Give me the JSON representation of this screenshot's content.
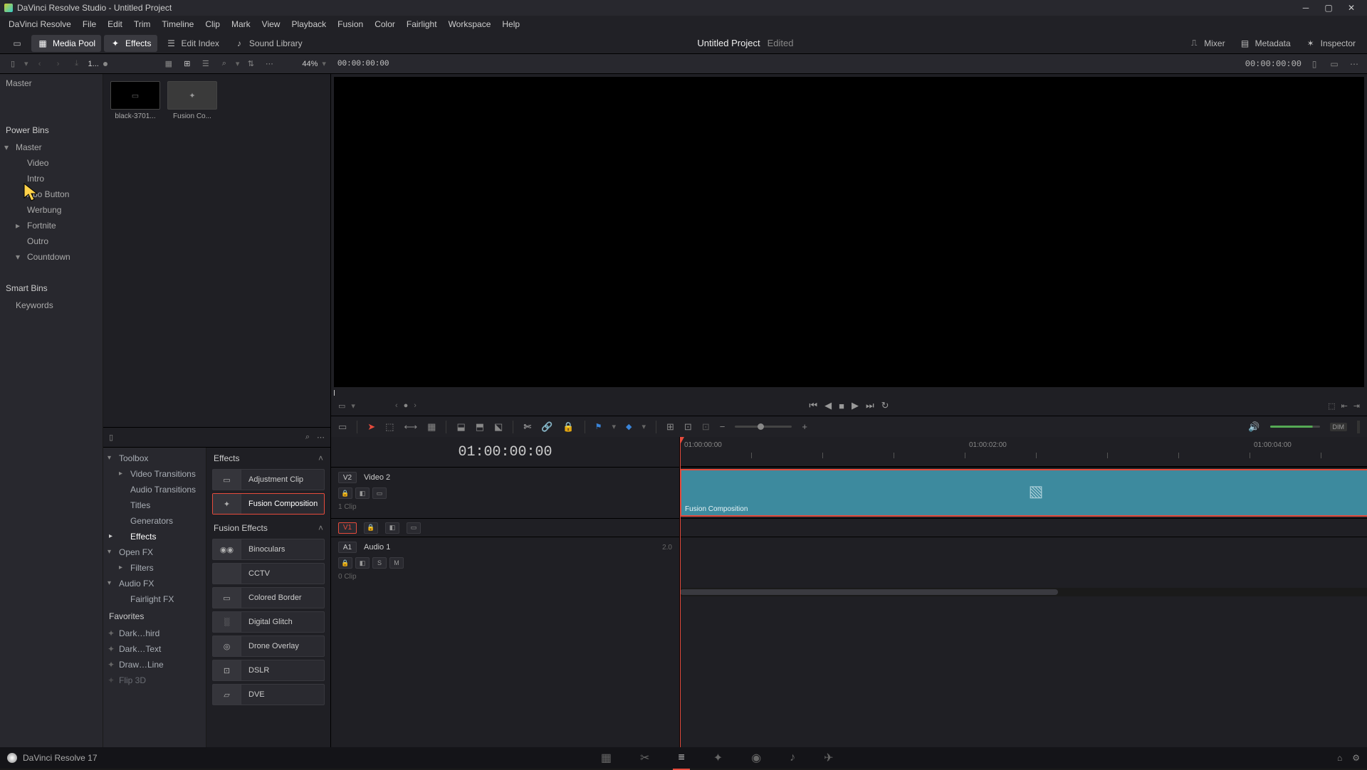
{
  "window": {
    "title": "DaVinci Resolve Studio - Untitled Project"
  },
  "menu": [
    "DaVinci Resolve",
    "File",
    "Edit",
    "Trim",
    "Timeline",
    "Clip",
    "Mark",
    "View",
    "Playback",
    "Fusion",
    "Color",
    "Fairlight",
    "Workspace",
    "Help"
  ],
  "toolbar_left": [
    {
      "id": "media-pool",
      "label": "Media Pool",
      "active": true
    },
    {
      "id": "effects",
      "label": "Effects",
      "active": true
    },
    {
      "id": "edit-index",
      "label": "Edit Index",
      "active": false
    },
    {
      "id": "sound-library",
      "label": "Sound Library",
      "active": false
    }
  ],
  "toolbar_center": {
    "project": "Untitled Project",
    "status": "Edited"
  },
  "toolbar_right": [
    {
      "id": "mixer",
      "label": "Mixer"
    },
    {
      "id": "metadata",
      "label": "Metadata"
    },
    {
      "id": "inspector",
      "label": "Inspector"
    }
  ],
  "secondbar": {
    "timeline_name": "1...",
    "zoom": "44%",
    "tc_left": "00:00:00:00",
    "tc_right": "00:00:00:00"
  },
  "bins": {
    "top": "Master",
    "power_label": "Power Bins",
    "power_items": [
      {
        "label": "Master",
        "expand": "down"
      },
      {
        "label": "Video",
        "lvl": 2
      },
      {
        "label": "Intro",
        "lvl": 2
      },
      {
        "label": "Abo Button",
        "lvl": 2
      },
      {
        "label": "Werbung",
        "lvl": 2
      },
      {
        "label": "Fortnite",
        "lvl": 2,
        "expand": "right"
      },
      {
        "label": "Outro",
        "lvl": 2
      },
      {
        "label": "Countdown",
        "lvl": 2,
        "expand": "down"
      }
    ],
    "smart_label": "Smart Bins",
    "smart_items": [
      {
        "label": "Keywords"
      }
    ]
  },
  "media": {
    "clips": [
      {
        "name": "black-3701...",
        "dark": true
      },
      {
        "name": "Fusion Co...",
        "dark": false
      }
    ]
  },
  "effects_tree": {
    "toolbox": "Toolbox",
    "toolbox_items": [
      {
        "label": "Video Transitions",
        "expand": "right"
      },
      {
        "label": "Audio Transitions"
      },
      {
        "label": "Titles"
      },
      {
        "label": "Generators"
      },
      {
        "label": "Effects",
        "selected": true,
        "expand": "right"
      }
    ],
    "openfx": "Open FX",
    "openfx_items": [
      {
        "label": "Filters",
        "expand": "right"
      }
    ],
    "audiofx": "Audio FX",
    "audiofx_items": [
      {
        "label": "Fairlight FX"
      }
    ],
    "favorites": "Favorites",
    "favorite_items": [
      {
        "label": "Dark…hird"
      },
      {
        "label": "Dark…Text"
      },
      {
        "label": "Draw…Line"
      },
      {
        "label": "Flip 3D"
      }
    ]
  },
  "effects_list": {
    "section1": "Effects",
    "section1_items": [
      {
        "name": "Adjustment Clip"
      },
      {
        "name": "Fusion Composition",
        "selected": true
      }
    ],
    "section2": "Fusion Effects",
    "section2_items": [
      {
        "name": "Binoculars"
      },
      {
        "name": "CCTV"
      },
      {
        "name": "Colored Border"
      },
      {
        "name": "Digital Glitch"
      },
      {
        "name": "Drone Overlay"
      },
      {
        "name": "DSLR"
      },
      {
        "name": "DVE"
      }
    ]
  },
  "timeline": {
    "tc_big": "01:00:00:00",
    "ruler": [
      {
        "pos": 0,
        "label": "01:00:00:00"
      },
      {
        "pos": 400,
        "label": "01:00:02:00"
      },
      {
        "pos": 800,
        "label": "01:00:04:00"
      }
    ],
    "tracks": [
      {
        "id": "V2",
        "name": "Video 2",
        "type": "video",
        "sub": "1 Clip"
      },
      {
        "id": "V1",
        "name": "",
        "type": "video-collapsed"
      },
      {
        "id": "A1",
        "name": "Audio 1",
        "type": "audio",
        "sub": "0 Clip",
        "meter": "2.0"
      }
    ],
    "clip": {
      "label": "Fusion Composition"
    }
  },
  "status_bar": {
    "app": "DaVinci Resolve 17"
  }
}
